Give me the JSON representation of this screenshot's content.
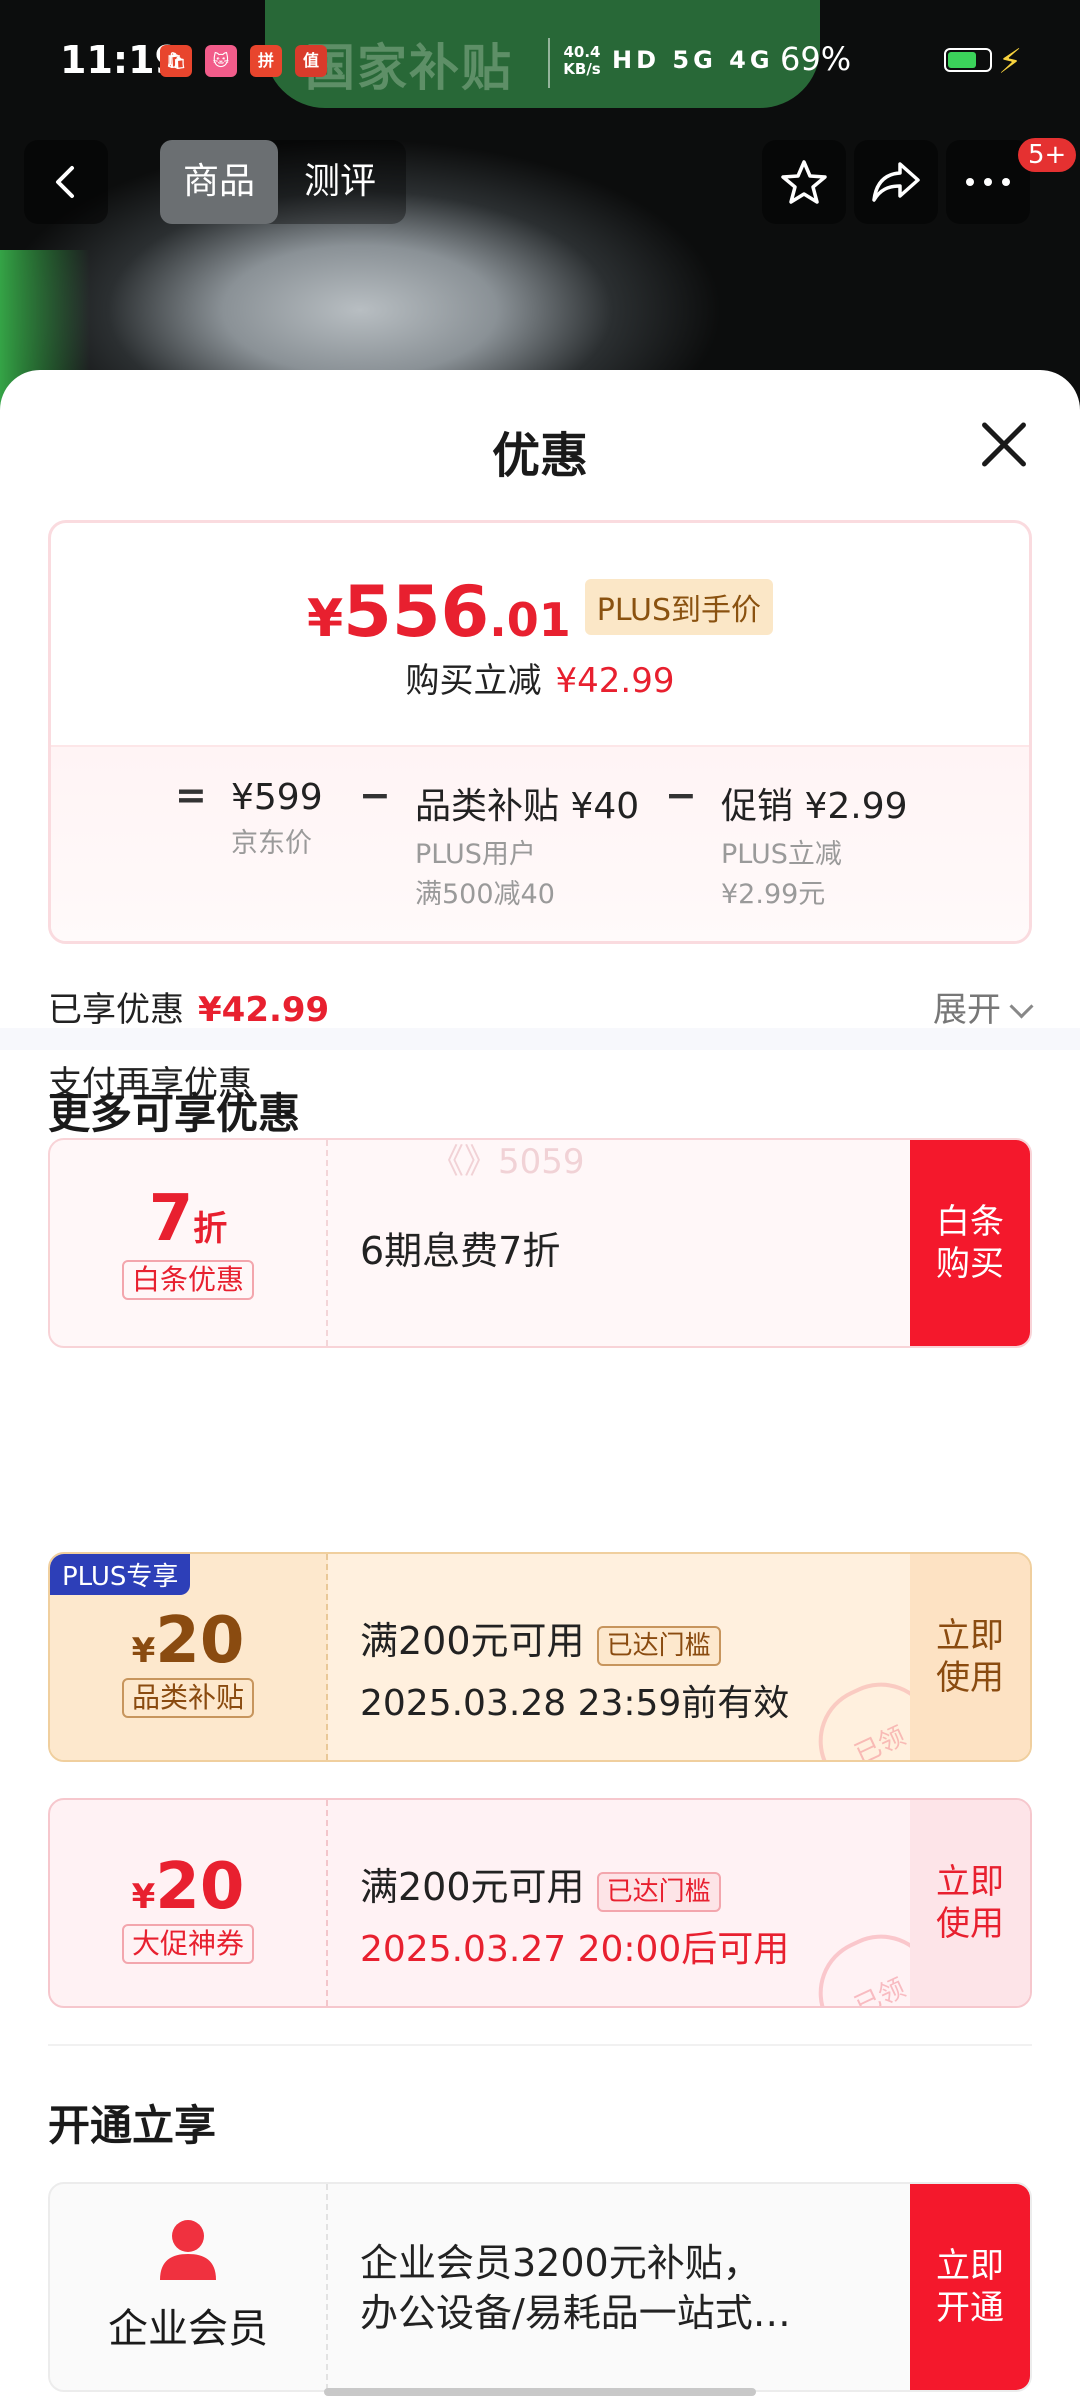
{
  "status_bar": {
    "time": "11:19",
    "apps": [
      "🛍",
      "🐱",
      "拼",
      "值"
    ],
    "network_speed": "40.4 KB/s",
    "indicators": "HD  5G  4G",
    "battery_percent": "69%",
    "battery_level": 0.69
  },
  "header": {
    "banner_text": "国家补贴",
    "back_icon": "chevron-left-icon",
    "tabs": [
      "商品",
      "测评"
    ],
    "active_tab": "商品",
    "favorite_icon": "star-icon",
    "share_icon": "share-icon",
    "more_icon": "more-icon",
    "more_badge": "5+"
  },
  "sheet": {
    "title": "优惠",
    "close_icon": "close-icon",
    "price_card": {
      "yen": "¥",
      "price_int": "556",
      "price_dec": ".01",
      "plus_tag": "PLUS到手价",
      "instant_label": "购买立减",
      "instant_value": "¥42.99",
      "eq": "=",
      "base_price": "¥599",
      "base_label": "京东价",
      "minus1": "−",
      "subsidy_title": "品类补贴 ¥40",
      "subsidy_line1": "PLUS用户",
      "subsidy_line2": "满500减40",
      "minus2": "−",
      "promo_title": "促销 ¥2.99",
      "promo_line1": "PLUS立减",
      "promo_line2": "¥2.99元"
    },
    "enjoyed_label": "已享优惠",
    "enjoyed_value": "¥42.99",
    "expand_label": "展开",
    "pay_more_label": "支付再享优惠",
    "baitiao": {
      "discount": "7",
      "discount_unit": "折",
      "tag": "白条优惠",
      "desc": "6期息费7折",
      "action": "白条\n购买",
      "watermark": "《》5059"
    },
    "more_section_title": "更多可享优惠",
    "coupons": [
      {
        "corner": "PLUS专享",
        "yen": "¥",
        "amount": "20",
        "tag": "品类补贴",
        "condition": "满200元可用",
        "threshold": "已达门槛",
        "validity": "2025.03.28 23:59前有效",
        "action": "立即\n使用",
        "stamp": "已领"
      },
      {
        "yen": "¥",
        "amount": "20",
        "tag": "大促神券",
        "condition": "满200元可用",
        "threshold": "已达门槛",
        "validity": "2025.03.27 20:00后可用",
        "action": "立即\n使用",
        "stamp": "已领"
      }
    ],
    "open_section_title": "开通立享",
    "enterprise": {
      "icon": "person-icon",
      "label": "企业会员",
      "line1": "企业会员3200元补贴，",
      "line2": "办公设备/易耗品一站式…",
      "action": "立即\n开通"
    }
  },
  "colors": {
    "accent_red": "#e8202f",
    "plus_blue": "#2d3fb8",
    "gold": "#8a5210"
  }
}
